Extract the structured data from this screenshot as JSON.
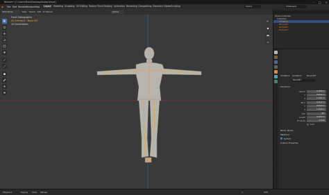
{
  "titlebar": {
    "title": "Blender* [C:\\Users\\Pixel\\Desktop\\Avatar.blend]"
  },
  "menubar": {
    "file": "File",
    "edit": "Edit",
    "render": "Render",
    "window": "Window",
    "help": "Help",
    "workspaces": [
      "Layout",
      "Modeling",
      "Sculpting",
      "UV Editing",
      "Texture Paint",
      "Shading",
      "Animation",
      "Rendering",
      "Compositing",
      "Geometry Nodes",
      "Scripting"
    ],
    "scene": "Scene",
    "view_layer": "ViewLayer"
  },
  "viewport": {
    "mode": "Edit Mode",
    "view_label": "Front Orthographic",
    "context_label": "(0) Armature : Bone.007",
    "units_label": "10 Centimeters",
    "header_items": [
      "View",
      "Select",
      "Add",
      "Armature"
    ],
    "transform": "Global"
  },
  "outliner": {
    "search_placeholder": "",
    "rows": [
      "Scene Collection",
      "Collection",
      "Armature",
      "Body.001",
      "Body.002",
      "Body.003"
    ]
  },
  "properties": {
    "breadcrumb": [
      "Armature",
      "Armature",
      "Bone.007"
    ],
    "bone_name": "Bone.007",
    "transform_header": "Transform",
    "head_label": "Head X",
    "labels": [
      "Head X",
      "Y",
      "Z",
      "Tail X",
      "Y",
      "Z",
      "Roll",
      "Length",
      "Envelope"
    ],
    "values": [
      "-0.1209 m",
      "0.0142 m",
      "1.3431 m",
      "-0.4122 m",
      "0.0114 m",
      "1.3529 m",
      "-90°",
      "0.2933 m",
      "0.1000"
    ],
    "lock_label": "Lock",
    "bendy_bones": "Bendy Bones",
    "relations": "Relations",
    "deform": "Deform",
    "custom_props": "Custom Properties"
  },
  "timeline": {
    "playback": "Playback",
    "keying": "Keying",
    "view": "View",
    "marker": "Marker",
    "start": "1",
    "end": "250"
  },
  "colors": {
    "accent": "#4772b3",
    "selection": "#ffa33a",
    "x_axis": "#8b3a3a",
    "y_axis": "#2d6fa3"
  }
}
